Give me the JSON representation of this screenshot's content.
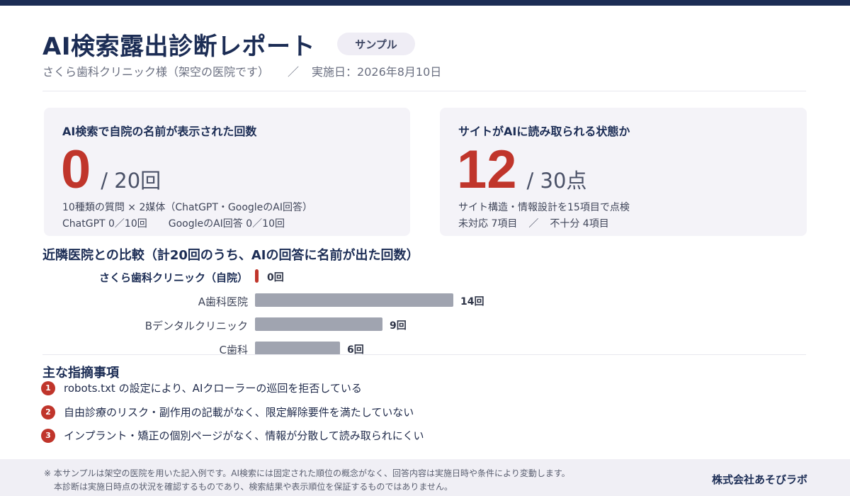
{
  "header": {
    "title": "AI検索露出診断レポート",
    "badge": "サンプル",
    "clinic": "さくら歯科クリニック様（架空の医院です）",
    "separator": "／",
    "date": "実施日：2026年8月10日"
  },
  "cards": {
    "mentions": {
      "label": "AI検索で自院の名前が表示された回数",
      "value": "0",
      "denominator": "/ 20回",
      "note1": "10種類の質問 × 2媒体（ChatGPT・GoogleのAI回答）",
      "note2a": "ChatGPT 0／10回",
      "note2b": "GoogleのAI回答 0／10回"
    },
    "readability": {
      "label": "サイトがAIに読み取られる状態か",
      "value": "12",
      "denominator": "/ 30点",
      "note1": "サイト構造・情報設計を15項目で点検",
      "note2a": "未対応 7項目",
      "note2sep": "／",
      "note2b": "不十分 4項目"
    }
  },
  "comparison": {
    "title": "近隣医院との比較（計20回のうち、AIの回答に名前が出た回数）"
  },
  "chart_data": {
    "type": "bar",
    "orientation": "horizontal",
    "categories": [
      "さくら歯科クリニック（自院）",
      "A歯科医院",
      "Bデンタルクリニック",
      "C歯科"
    ],
    "values": [
      0,
      14,
      9,
      6
    ],
    "value_labels": [
      "0回",
      "14回",
      "9回",
      "6回"
    ],
    "xlim": [
      0,
      20
    ],
    "highlight_index": 0,
    "colors": {
      "self": "#c0352b",
      "others": "#a0a4b0"
    }
  },
  "findings": {
    "title": "主な指摘事項",
    "items": [
      {
        "num": "1",
        "text": "robots.txt の設定により、AIクローラーの巡回を拒否している"
      },
      {
        "num": "2",
        "text": "自由診療のリスク・副作用の記載がなく、限定解除要件を満たしていない"
      },
      {
        "num": "3",
        "text": "インプラント・矯正の個別ページがなく、情報が分散して読み取られにくい"
      }
    ]
  },
  "footer": {
    "note1": "※ 本サンプルは架空の医院を用いた記入例です。AI検索には固定された順位の概念がなく、回答内容は実施日時や条件により変動します。",
    "note2": "本診断は実施日時点の状況を確認するものであり、検索結果や表示順位を保証するものではありません。",
    "company": "株式会社あそびラボ"
  },
  "colors": {
    "navy": "#1c2d55",
    "accent_red": "#c0352b",
    "card_bg": "#f4f3f8",
    "bar_gray": "#a0a4b0"
  }
}
